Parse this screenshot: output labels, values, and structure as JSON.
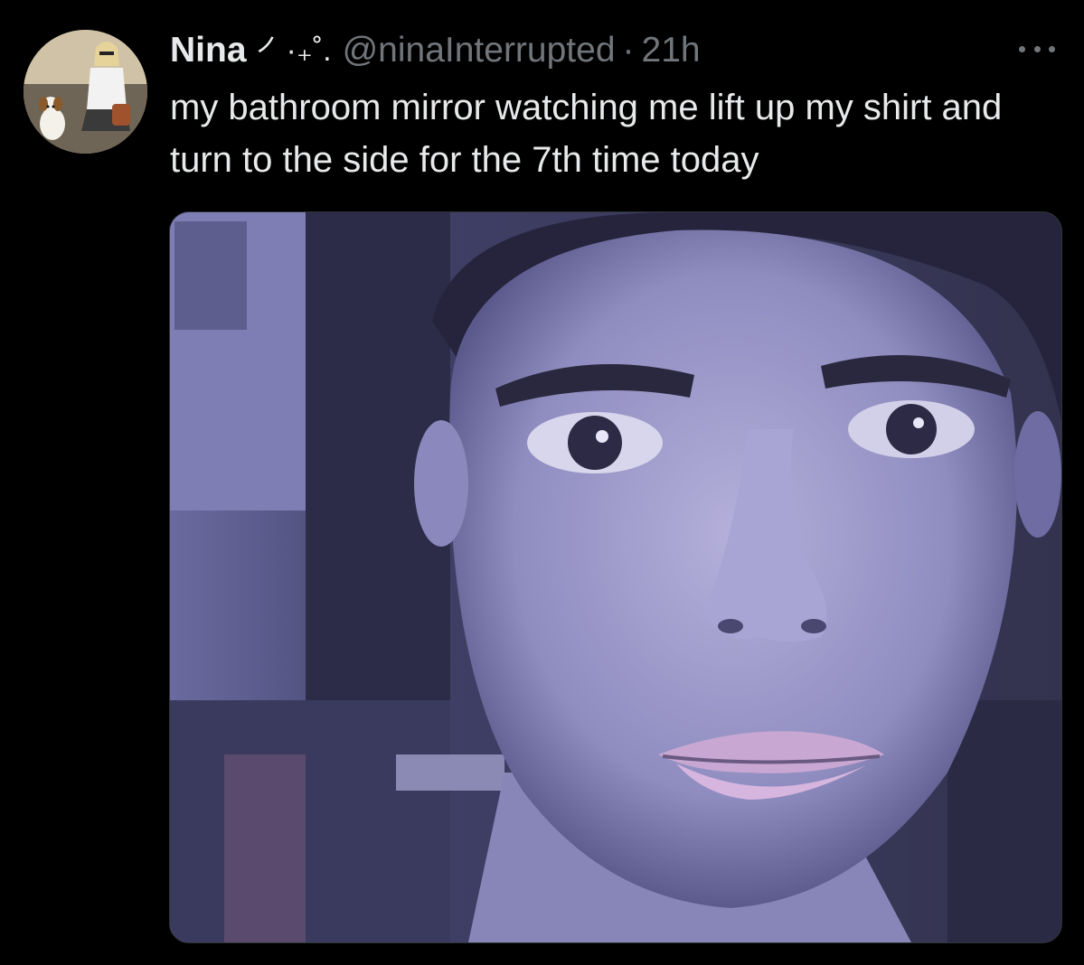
{
  "tweet": {
    "display_name": "Nina",
    "name_emoji": "㇒·₊˚.",
    "handle": "@ninaInterrupted",
    "separator": "·",
    "timestamp": "21h",
    "text": "my bathroom mirror watching me lift up my shirt and turn to the side for the 7th time today",
    "more_icon": "more-horizontal-icon"
  },
  "media": {
    "description_icon": "photo",
    "tint_color": "#6c6ca8"
  },
  "colors": {
    "background": "#000000",
    "primary_text": "#e7e9ea",
    "secondary_text": "#71767b"
  }
}
